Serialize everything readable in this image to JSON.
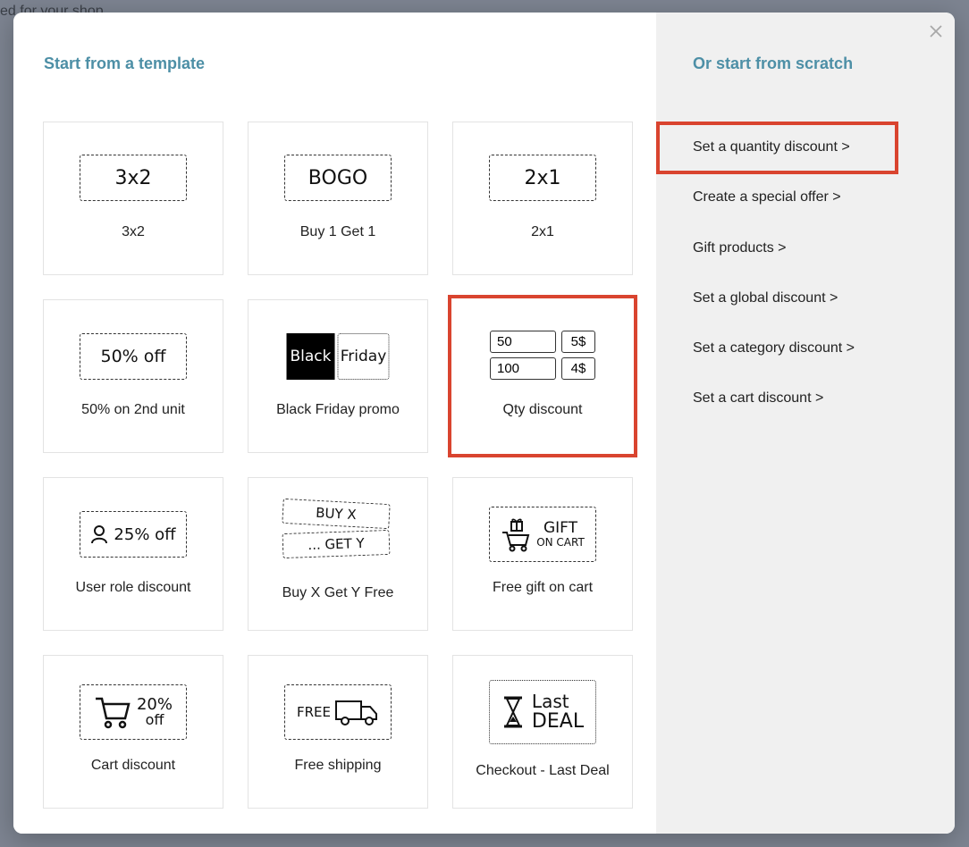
{
  "background": {
    "partial_text": "ed for your shop"
  },
  "modal": {
    "left_title": "Start from a template",
    "right_title": "Or start from scratch",
    "close_label": "×"
  },
  "templates": [
    {
      "label": "3x2",
      "icon_text": "3x2"
    },
    {
      "label": "Buy 1 Get 1",
      "icon_text": "BOGO"
    },
    {
      "label": "2x1",
      "icon_text": "2x1"
    },
    {
      "label": "50% on 2nd unit",
      "icon_text": "50% off"
    },
    {
      "label": "Black Friday promo",
      "icon_text_a": "Black",
      "icon_text_b": "Friday"
    },
    {
      "label": "Qty discount",
      "qty_rows": [
        [
          "50",
          "5$"
        ],
        [
          "100",
          "4$"
        ]
      ]
    },
    {
      "label": "User role discount",
      "icon_text": "25% off"
    },
    {
      "label": "Buy X Get Y Free",
      "icon_text_a": "BUY X",
      "icon_text_b": "... GET Y"
    },
    {
      "label": "Free gift on cart",
      "icon_text_a": "GIFT",
      "icon_text_b": "ON CART"
    },
    {
      "label": "Cart discount",
      "icon_text_a": "20%",
      "icon_text_b": "off"
    },
    {
      "label": "Free shipping",
      "icon_text": "FREE"
    },
    {
      "label": "Checkout - Last Deal",
      "icon_text_a": "Last",
      "icon_text_b": "DEAL"
    }
  ],
  "scratch": [
    "Set a quantity discount >",
    "Create a special offer >",
    "Gift products >",
    "Set a global discount >",
    "Set a category discount >",
    "Set a cart discount >"
  ],
  "colors": {
    "accent_title": "#4d8fa6",
    "highlight": "#d9442f",
    "right_pane_bg": "#f0f0f0"
  }
}
